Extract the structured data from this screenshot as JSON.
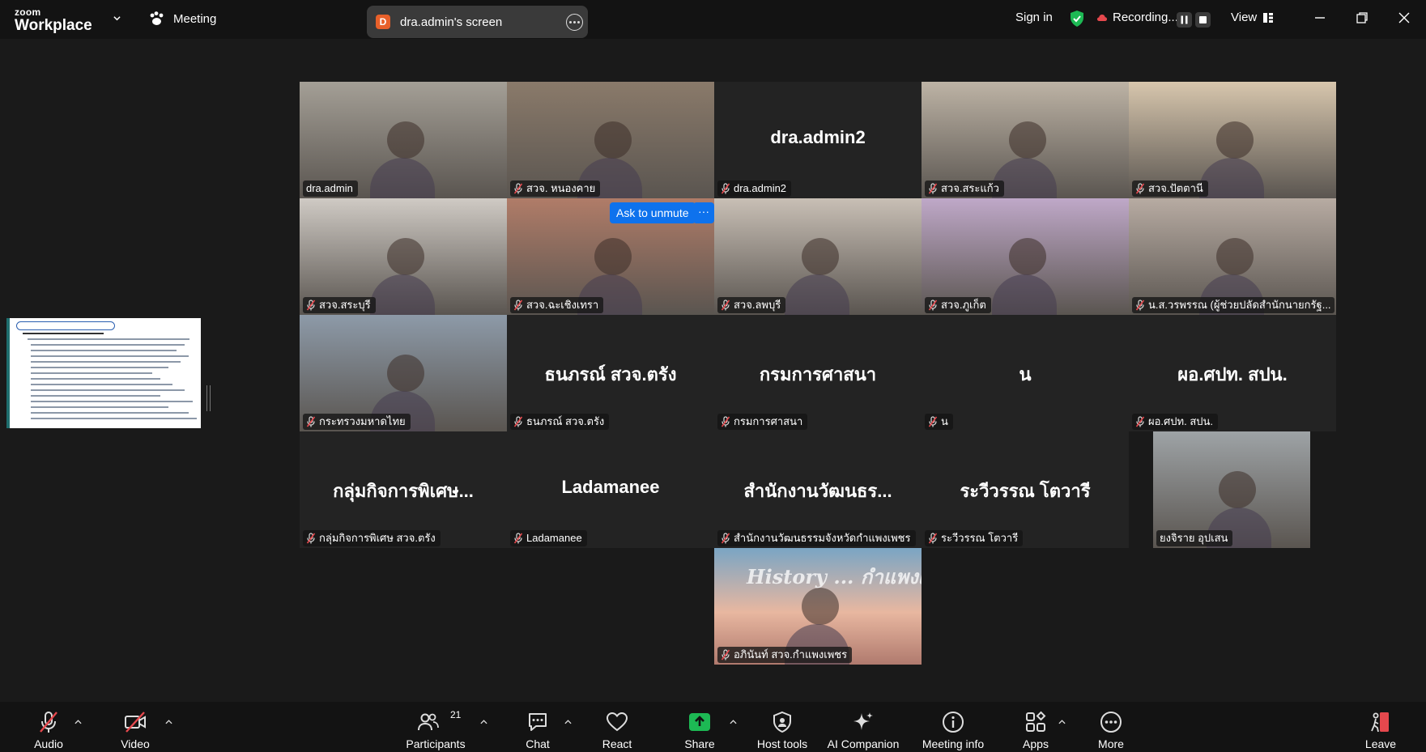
{
  "app": {
    "brand_top": "zoom",
    "brand_bottom": "Workplace",
    "meeting_label": "Meeting"
  },
  "share_indicator": {
    "badge": "D",
    "text": "dra.admin's screen"
  },
  "titlebar": {
    "sign_in": "Sign in",
    "recording": "Recording...",
    "view": "View"
  },
  "ask_to_unmute": {
    "label": "Ask to unmute",
    "more": "···"
  },
  "tiles": [
    {
      "name": "dra.admin",
      "muted": false,
      "active": true,
      "type": "video",
      "tone": "#a49f96"
    },
    {
      "name": "สวจ. หนองคาย",
      "muted": true,
      "type": "video",
      "tone": "#8a7a6a"
    },
    {
      "name": "dra.admin2",
      "muted": true,
      "type": "text",
      "big": "dra.admin2"
    },
    {
      "name": "สวจ.สระแก้ว",
      "muted": true,
      "type": "video",
      "tone": "#bdb3a5"
    },
    {
      "name": "สวจ.ปัตตานี",
      "muted": true,
      "type": "video",
      "tone": "#d7c6ad"
    },
    {
      "name": "สวจ.สระบุรี",
      "muted": true,
      "type": "video",
      "tone": "#cfcac4"
    },
    {
      "name": "สวจ.ฉะเชิงเทรา",
      "muted": true,
      "type": "video",
      "tone": "#b07c68"
    },
    {
      "name": "สวจ.ลพบุรี",
      "muted": true,
      "type": "video",
      "tone": "#c8bfb5"
    },
    {
      "name": "สวจ.ภูเก็ต",
      "muted": true,
      "type": "video",
      "tone": "#bfa8c8"
    },
    {
      "name": "น.ส.วรพรรณ (ผู้ช่วยปลัดสำนักนายกรัฐ...",
      "muted": true,
      "type": "video",
      "tone": "#b7aba2"
    },
    {
      "name": "กระทรวงมหาดไทย",
      "muted": true,
      "type": "video",
      "tone": "#8d9aa8"
    },
    {
      "name": "ธนภรณ์ สวจ.ตรัง",
      "muted": true,
      "type": "text",
      "big": "ธนภรณ์ สวจ.ตรัง"
    },
    {
      "name": "กรมการศาสนา",
      "muted": true,
      "type": "text",
      "big": "กรมการศาสนา"
    },
    {
      "name": "น",
      "muted": true,
      "type": "text",
      "big": "น"
    },
    {
      "name": "ผอ.ศปท. สปน.",
      "muted": true,
      "type": "text",
      "big": "ผอ.ศปท. สปน."
    },
    {
      "name": "กลุ่มกิจการพิเศษ สวจ.ตรัง",
      "muted": true,
      "type": "text",
      "big": "กลุ่มกิจการพิเศษ..."
    },
    {
      "name": "Ladamanee",
      "muted": true,
      "type": "text",
      "big": "Ladamanee"
    },
    {
      "name": "สำนักงานวัฒนธรรมจังหวัดกำแพงเพชร",
      "muted": true,
      "type": "text",
      "big": "สำนักงานวัฒนธร..."
    },
    {
      "name": "ระวีวรรณ โตวารี",
      "muted": true,
      "type": "text",
      "big": "ระวีวรรณ โตวารี"
    },
    {
      "name": "ยงจิราย อุปเสน",
      "muted": false,
      "type": "video",
      "tone": "#9ea3a6"
    },
    {
      "name": "อภินันท์ สวจ.กำแพงเพชร",
      "muted": true,
      "type": "video",
      "tone": "#c9a79a",
      "overlay": "History ... กำแพงเพชร"
    }
  ],
  "toolbar": {
    "audio": "Audio",
    "video": "Video",
    "participants": "Participants",
    "participants_count": "21",
    "chat": "Chat",
    "react": "React",
    "share": "Share",
    "host_tools": "Host tools",
    "ai_companion": "AI Companion",
    "meeting_info": "Meeting info",
    "apps": "Apps",
    "more": "More",
    "leave": "Leave"
  },
  "colors": {
    "accent_green": "#2fdc7d",
    "share_green": "#1db954",
    "ask_blue": "#0e72ed",
    "mute_red": "#e5484d",
    "leave_red": "#e5484d"
  }
}
